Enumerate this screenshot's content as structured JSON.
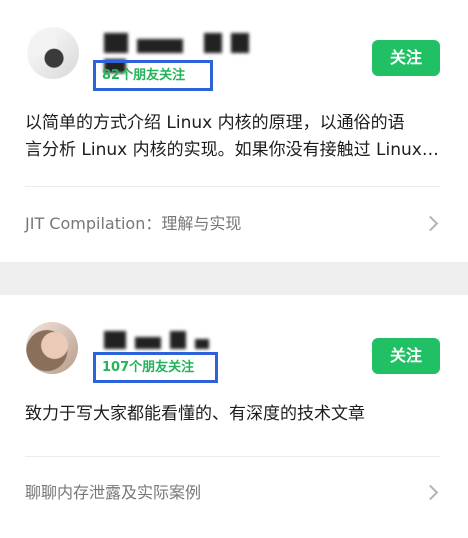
{
  "cards": [
    {
      "friends_label": "82个朋友关注",
      "follow_label": "关注",
      "desc_line1": "以简单的方式介绍 Linux 内核的原理，以通俗的语",
      "desc_line2": "言分析 Linux 内核的实现。如果你没有接触过 Linux…",
      "article_link": "JIT Compilation：理解与实现"
    },
    {
      "friends_label": "107个朋友关注",
      "follow_label": "关注",
      "desc_line1": "致力于写大家都能看懂的、有深度的技术文章",
      "article_link": "聊聊内存泄露及实际案例"
    }
  ],
  "colors": {
    "follow_button": "#22c065",
    "friends_text": "#24b35a",
    "highlight_box": "#2d63d8",
    "separator": "#efefef"
  }
}
